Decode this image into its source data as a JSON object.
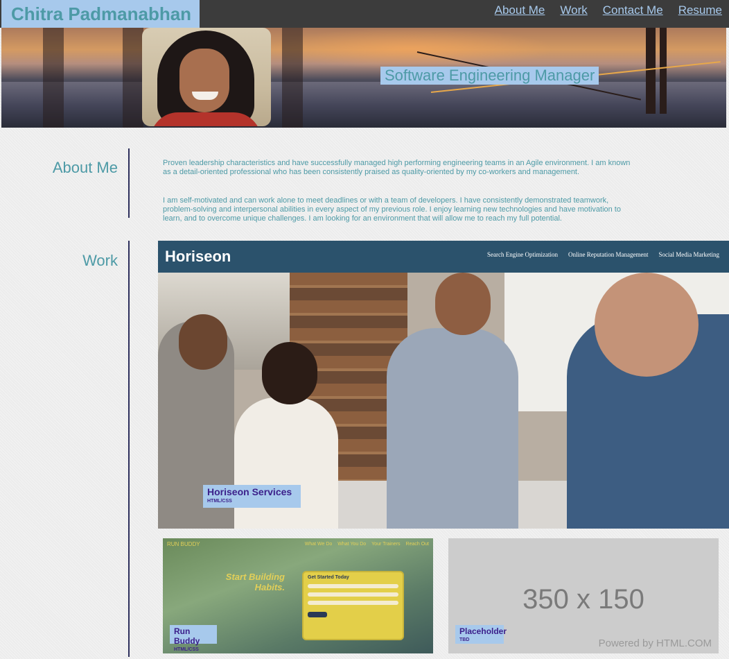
{
  "header": {
    "name": "Chitra Padmanabhan",
    "nav": [
      "About Me",
      "Work",
      "Contact Me",
      "Resume"
    ]
  },
  "hero": {
    "title": "Software Engineering Manager"
  },
  "about": {
    "heading": "About Me",
    "paragraph_1": "Proven leadership characteristics and have successfully managed high performing engineering teams in an Agile environment. I am known as a detail-oriented professional who has been consistently praised as quality-oriented by my co-workers and management.",
    "paragraph_2": "I am self-motivated and can work alone to meet deadlines or with a team of developers. I have consistently demonstrated teamwork, problem-solving and interpersonal abilities in every aspect of my previous role. I enjoy learning new technologies and have motivation to learn, and to overcome unique challenges. I am looking for an environment that will allow me to reach my full potential."
  },
  "work": {
    "heading": "Work",
    "featured": {
      "site_logo": "Horiseon",
      "site_nav": [
        "Search Engine Optimization",
        "Online Reputation Management",
        "Social Media Marketing"
      ],
      "title": "Horiseon Services",
      "subtitle": "HTML/CSS"
    },
    "projects": [
      {
        "title": "Run Buddy",
        "subtitle": "HTML/CSS",
        "shot_logo": "RUN BUDDY",
        "shot_nav": [
          "What We Do",
          "What You Do",
          "Your Trainers",
          "Reach Out"
        ],
        "shot_headline": "Start Building Habits.",
        "shot_form_title": "Get Started Today"
      },
      {
        "title": "Placeholder",
        "subtitle": "TBD",
        "shot_size": "350 x 150",
        "shot_powered": "Powered by HTML.COM"
      }
    ]
  },
  "colors": {
    "accent": "#4d9aa6",
    "label_bg": "#a7c9ec",
    "header_bg": "#3c3c3c",
    "caption_text": "#3b1f8a"
  }
}
